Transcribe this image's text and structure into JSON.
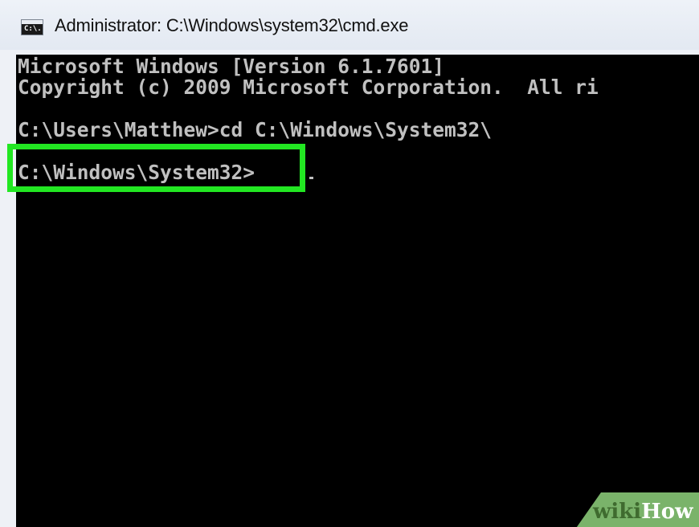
{
  "window": {
    "title": "Administrator: C:\\Windows\\system32\\cmd.exe",
    "icon_glyph": "C:\\."
  },
  "console": {
    "lines": [
      "Microsoft Windows [Version 6.1.7601]",
      "Copyright (c) 2009 Microsoft Corporation.  All ri",
      "C:\\Users\\Matthew>cd C:\\Windows\\System32\\",
      "C:\\Windows\\System32>"
    ]
  },
  "watermark": {
    "wiki": "wiki",
    "how": "How"
  },
  "colors": {
    "console_bg": "#000000",
    "console_text": "#c0c0c0",
    "highlight": "#22e722",
    "watermark_bg": "#7ab36a"
  }
}
